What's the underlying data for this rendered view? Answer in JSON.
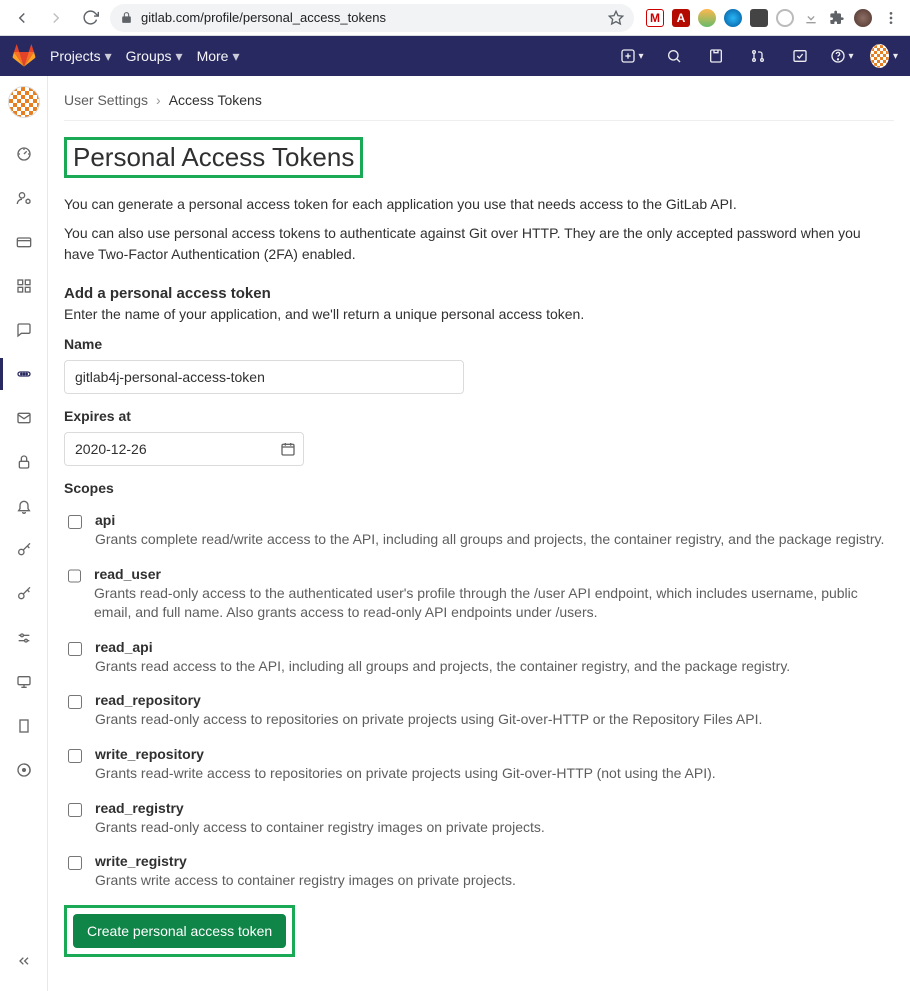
{
  "browser": {
    "url": "gitlab.com/profile/personal_access_tokens",
    "extensions": [
      "mcafee",
      "adobe",
      "avast",
      "opera",
      "pocket",
      "circle",
      "download",
      "puzzle",
      "profile"
    ]
  },
  "topnav": {
    "items": [
      "Projects",
      "Groups",
      "More"
    ]
  },
  "breadcrumb": {
    "parent": "User Settings",
    "current": "Access Tokens"
  },
  "page": {
    "title": "Personal Access Tokens",
    "desc1": "You can generate a personal access token for each application you use that needs access to the GitLab API.",
    "desc2": "You can also use personal access tokens to authenticate against Git over HTTP. They are the only accepted password when you have Two-Factor Authentication (2FA) enabled.",
    "add_heading": "Add a personal access token",
    "add_sub": "Enter the name of your application, and we'll return a unique personal access token.",
    "name_label": "Name",
    "name_value": "gitlab4j-personal-access-token",
    "expires_label": "Expires at",
    "expires_value": "2020-12-26",
    "scopes_label": "Scopes",
    "create_label": "Create personal access token"
  },
  "scopes": [
    {
      "name": "api",
      "desc": "Grants complete read/write access to the API, including all groups and projects, the container registry, and the package registry."
    },
    {
      "name": "read_user",
      "desc": "Grants read-only access to the authenticated user's profile through the /user API endpoint, which includes username, public email, and full name. Also grants access to read-only API endpoints under /users."
    },
    {
      "name": "read_api",
      "desc": "Grants read access to the API, including all groups and projects, the container registry, and the package registry."
    },
    {
      "name": "read_repository",
      "desc": "Grants read-only access to repositories on private projects using Git-over-HTTP or the Repository Files API."
    },
    {
      "name": "write_repository",
      "desc": "Grants read-write access to repositories on private projects using Git-over-HTTP (not using the API)."
    },
    {
      "name": "read_registry",
      "desc": "Grants read-only access to container registry images on private projects."
    },
    {
      "name": "write_registry",
      "desc": "Grants write access to container registry images on private projects."
    }
  ],
  "sidebar": {
    "items": [
      {
        "icon": "dashboard"
      },
      {
        "icon": "person-gear"
      },
      {
        "icon": "credit-card"
      },
      {
        "icon": "applications"
      },
      {
        "icon": "chat"
      },
      {
        "icon": "token",
        "active": true
      },
      {
        "icon": "mail"
      },
      {
        "icon": "lock"
      },
      {
        "icon": "bell"
      },
      {
        "icon": "key"
      },
      {
        "icon": "key"
      },
      {
        "icon": "sliders"
      },
      {
        "icon": "monitor"
      },
      {
        "icon": "building"
      },
      {
        "icon": "usage"
      }
    ]
  }
}
